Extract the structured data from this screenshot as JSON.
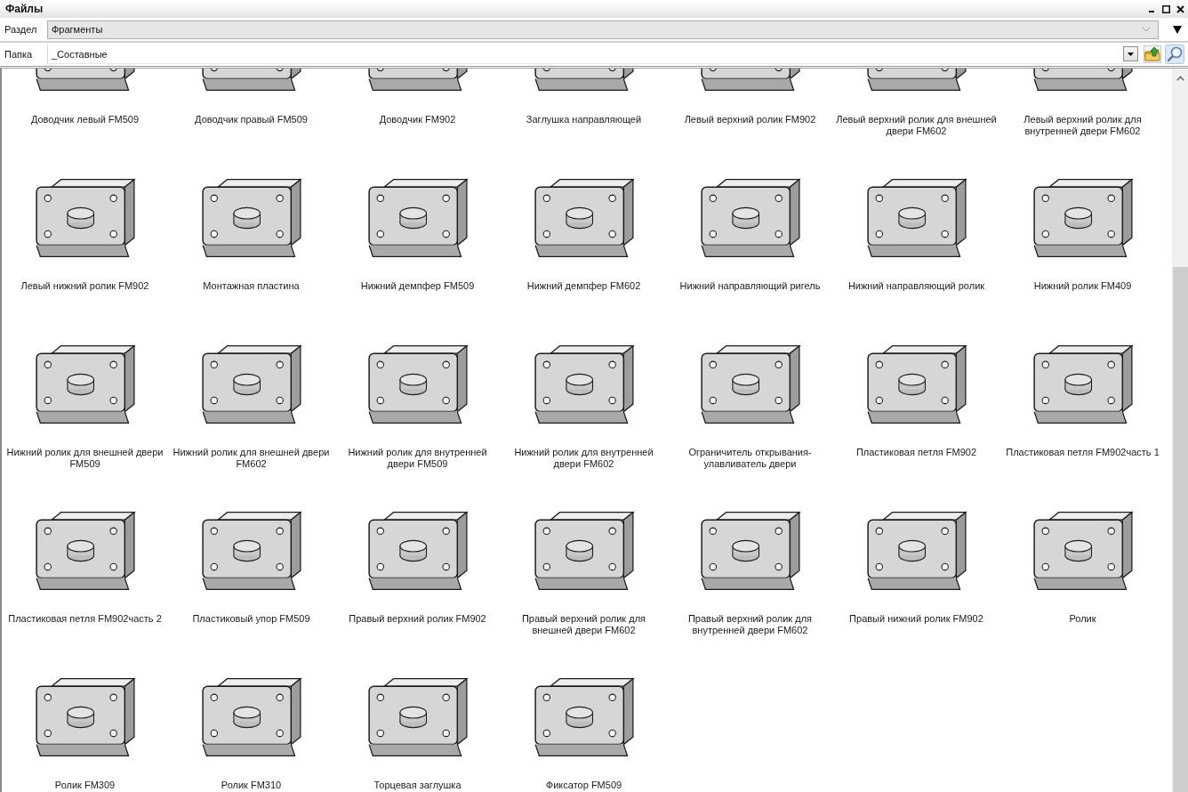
{
  "window": {
    "title": "Файлы"
  },
  "section": {
    "label": "Раздел",
    "value": "Фрагменты"
  },
  "folder": {
    "label": "Папка",
    "value": "_Составные"
  },
  "items": [
    {
      "name": "Доводчик левый FM509"
    },
    {
      "name": "Доводчик правый FM509"
    },
    {
      "name": "Доводчик FM902"
    },
    {
      "name": "Заглушка направляющей"
    },
    {
      "name": "Левый верхний ролик FM902"
    },
    {
      "name": "Левый верхний ролик для внешней двери FM602"
    },
    {
      "name": "Левый верхний ролик для внутренней двери FM602"
    },
    {
      "name": "Левый нижний ролик FM902"
    },
    {
      "name": "Монтажная пластина"
    },
    {
      "name": "Нижний демпфер FM509"
    },
    {
      "name": "Нижний демпфер FM602"
    },
    {
      "name": "Нижний направляющий ригель"
    },
    {
      "name": "Нижний направляющий ролик"
    },
    {
      "name": "Нижний ролик FM409"
    },
    {
      "name": "Нижний ролик для внешней двери FM509"
    },
    {
      "name": "Нижний ролик для внешней двери FM602"
    },
    {
      "name": "Нижний ролик для внутренней двери FM509"
    },
    {
      "name": "Нижний ролик для внутренней двери FM602"
    },
    {
      "name": "Ограничитель открывания-улавливатель двери"
    },
    {
      "name": "Пластиковая петля FM902"
    },
    {
      "name": "Пластиковая петля FM902часть 1"
    },
    {
      "name": "Пластиковая петля FM902часть 2"
    },
    {
      "name": "Пластиковый упор FM509"
    },
    {
      "name": "Правый верхний ролик FM902"
    },
    {
      "name": "Правый верхний ролик для внешней двери FM602"
    },
    {
      "name": "Правый верхний ролик для внутренней двери FM602"
    },
    {
      "name": "Правый нижний ролик FM902"
    },
    {
      "name": "Ролик"
    },
    {
      "name": "Ролик FM309"
    },
    {
      "name": "Ролик FM310"
    },
    {
      "name": "Торцевая заглушка"
    },
    {
      "name": "Фиксатор FM509"
    }
  ]
}
